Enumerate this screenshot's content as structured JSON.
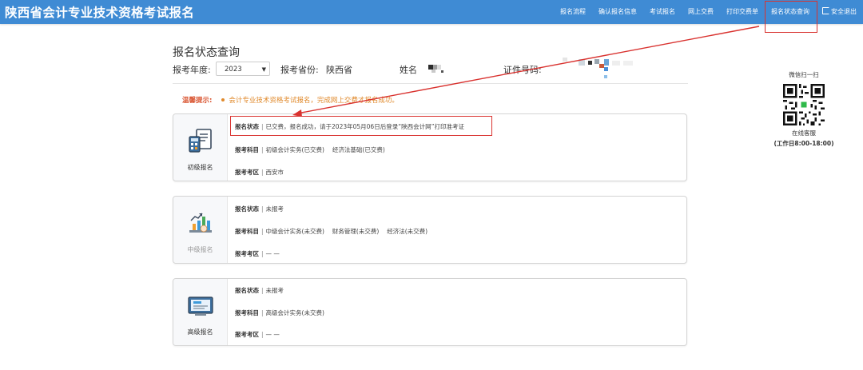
{
  "header": {
    "site_title": "陕西省会计专业技术资格考试报名",
    "nav": [
      {
        "label": "报名流程"
      },
      {
        "label": "确认报名信息"
      },
      {
        "label": "考试报名"
      },
      {
        "label": "网上交费"
      },
      {
        "label": "打印交费单"
      },
      {
        "label": "报名状态查询"
      },
      {
        "label": "安全退出"
      }
    ],
    "accent_color": "#3f8bd4"
  },
  "page": {
    "title": "报名状态查询",
    "year_label": "报考年度:",
    "year_value": "2023",
    "province_label": "报考省份:",
    "province_value": "陕西省",
    "name_label": "姓名",
    "id_label": "证件号码:"
  },
  "notice": {
    "label": "温馨提示:",
    "text": "会计专业技术资格考试报名，完成网上交费才报名成功。"
  },
  "cards": [
    {
      "level": "初级报名",
      "status_label": "报名状态",
      "status_value": "已交费，报名成功，请于2023年05月06日后登录“陕西会计网”打印准考证",
      "subject_label": "报考科目",
      "subjects": [
        "初级会计实务(已交费)",
        "经济法基础(已交费)"
      ],
      "area_label": "报考考区",
      "area_value": "西安市"
    },
    {
      "level": "中级报名",
      "status_label": "报名状态",
      "status_value": "未报考",
      "subject_label": "报考科目",
      "subjects": [
        "中级会计实务(未交费)",
        "财务管理(未交费)",
        "经济法(未交费)"
      ],
      "area_label": "报考考区",
      "area_value": "— —"
    },
    {
      "level": "高级报名",
      "status_label": "报名状态",
      "status_value": "未报考",
      "subject_label": "报考科目",
      "subjects": [
        "高级会计实务(未交费)"
      ],
      "area_label": "报考考区",
      "area_value": "— —"
    }
  ],
  "qr": {
    "title": "微信扫一扫",
    "subtitle": "在线客服",
    "hours": "(工作日8:00-18:00)"
  },
  "highlight_color": "#d9322f"
}
